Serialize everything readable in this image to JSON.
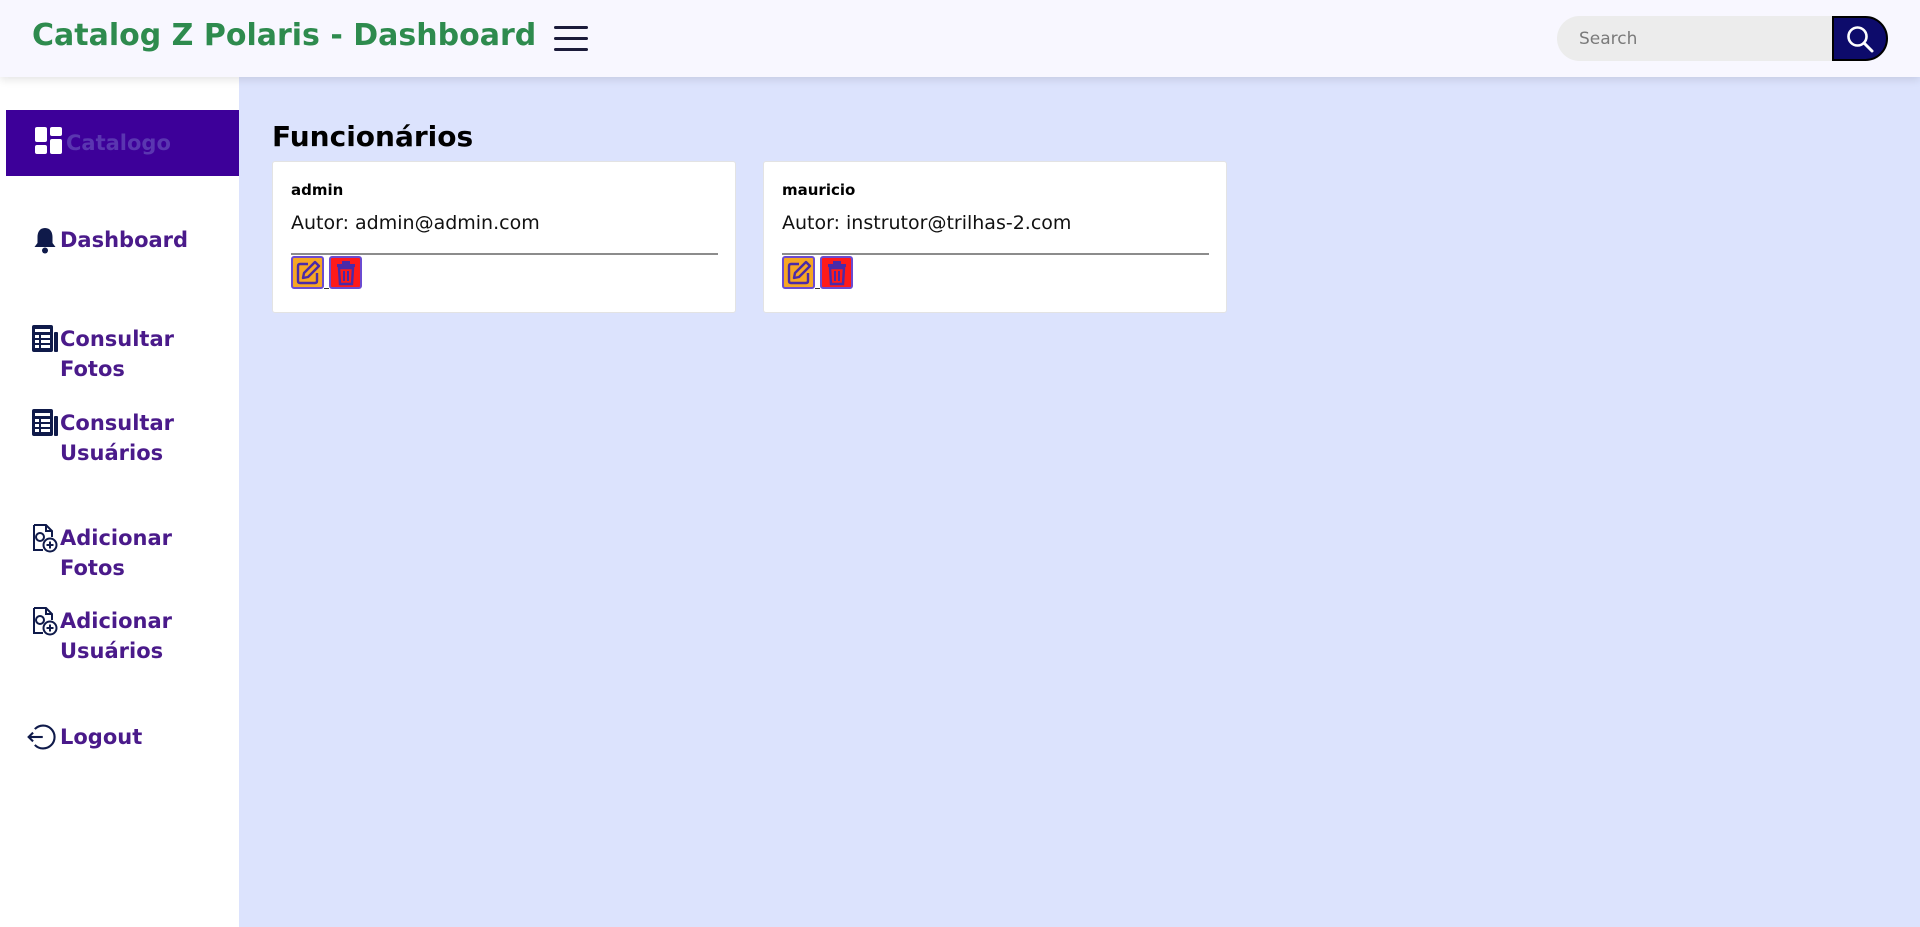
{
  "header": {
    "title": "Catalog Z Polaris - Dashboard",
    "search_placeholder": "Search"
  },
  "sidebar": {
    "items": [
      {
        "label": "Catalogo",
        "icon": "grid-icon",
        "active": true
      },
      {
        "label": "Dashboard",
        "icon": "bell-icon"
      },
      {
        "label": "Consultar Fotos",
        "icon": "table-list-icon"
      },
      {
        "label": "Consultar Usuários",
        "icon": "table-list-icon"
      },
      {
        "label": "Adicionar Fotos",
        "icon": "file-add-icon"
      },
      {
        "label": "Adicionar Usuários",
        "icon": "file-add-icon"
      },
      {
        "label": "Logout",
        "icon": "logout-icon"
      }
    ]
  },
  "main": {
    "title": "Funcionários",
    "cards": [
      {
        "name": "admin",
        "author": "Autor: admin@admin.com"
      },
      {
        "name": "mauricio",
        "author": "Autor: instrutor@trilhas-2.com"
      }
    ]
  },
  "colors": {
    "brand_green": "#2e8b4e",
    "accent_purple": "#3d0099",
    "nav_text": "#4a1a8a",
    "content_bg": "#dce3fd",
    "edit_button": "#f6a623",
    "delete_button": "#ff1a1a",
    "search_button": "#0d0b6b"
  }
}
